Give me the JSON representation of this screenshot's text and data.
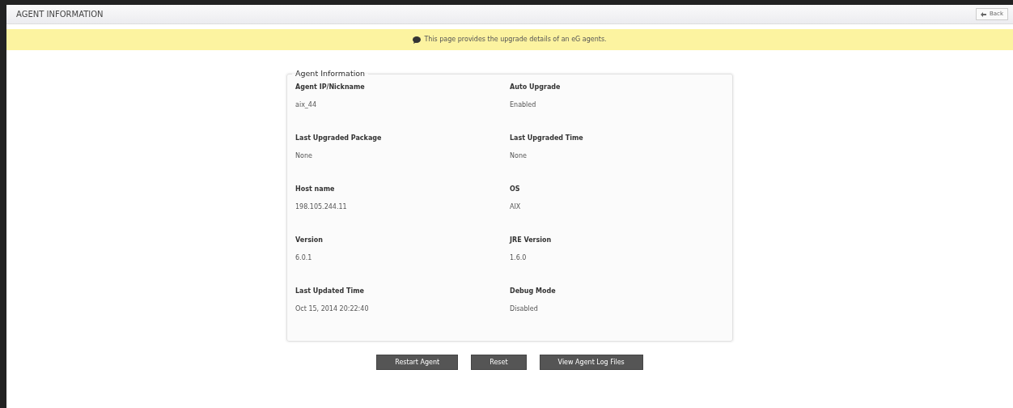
{
  "header": {
    "title": "AGENT INFORMATION",
    "back_button": "Back"
  },
  "notice": "This page provides the upgrade details of an eG agents.",
  "panel": {
    "legend": "Agent Information",
    "fields": [
      {
        "label": "Agent IP/Nickname",
        "value": "aix_44"
      },
      {
        "label": "Auto Upgrade",
        "value": "Enabled"
      },
      {
        "label": "Last Upgraded Package",
        "value": "None"
      },
      {
        "label": "Last Upgraded Time",
        "value": "None"
      },
      {
        "label": "Host name",
        "value": "198.105.244.11"
      },
      {
        "label": "OS",
        "value": "AIX"
      },
      {
        "label": "Version",
        "value": "6.0.1"
      },
      {
        "label": "JRE Version",
        "value": "1.6.0"
      },
      {
        "label": "Last Updated Time",
        "value": "Oct 15, 2014 20:22:40"
      },
      {
        "label": "Debug Mode",
        "value": "Disabled"
      }
    ]
  },
  "buttons": [
    "Restart Agent",
    "Reset",
    "View Agent Log Files"
  ]
}
